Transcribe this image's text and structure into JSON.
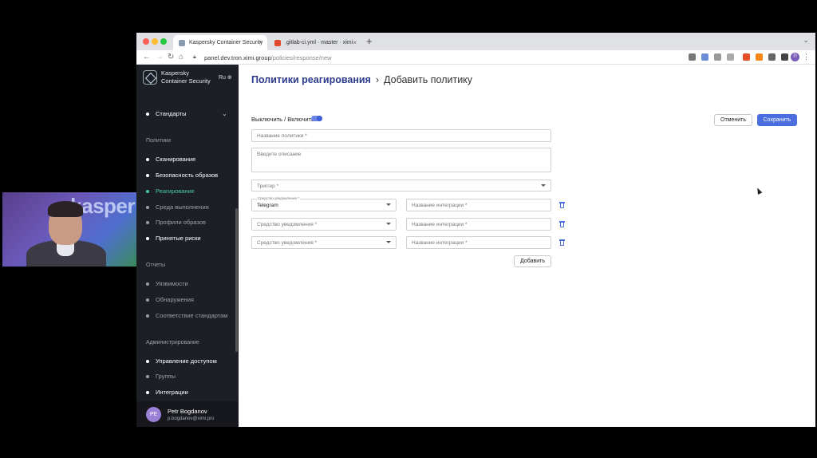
{
  "webcam": {
    "brand_text": "kasper"
  },
  "browser": {
    "tabs": [
      {
        "title": "Kaspersky Container Security",
        "favicon_color": "#8a9bb0"
      },
      {
        "title": ".gitlab-ci.yml · master · ximi",
        "favicon_color": "#e2492f"
      }
    ],
    "new_tab_icon": "+",
    "address": {
      "host": "panel.dev.tron.ximi.group",
      "path": "/policies/response/new"
    }
  },
  "sidebar": {
    "brand_line1": "Kaspersky",
    "brand_line2": "Container Security",
    "lang": "Ru",
    "items": {
      "standards": "Стандарты",
      "section_policies": "Политики",
      "scanning": "Сканирование",
      "image_security": "Безопасность образов",
      "response": "Реагирование",
      "runtime": "Среда выполнения",
      "image_profiles": "Профили образов",
      "accepted_risks": "Принятые риски",
      "section_reports": "Отчеты",
      "vulnerabilities": "Уязвимости",
      "detections": "Обнаружения",
      "compliance": "Соответствие стандартам",
      "section_admin": "Администрирование",
      "access_control": "Управление доступом",
      "groups": "Группы",
      "integrations": "Интеграции"
    },
    "user": {
      "initials": "PE",
      "name": "Petr Bogdanov",
      "email": "p.bogdanov@ximi.pro"
    }
  },
  "main": {
    "breadcrumb_root": "Политики реагирования",
    "breadcrumb_sep": "›",
    "breadcrumb_current": "Добавить политику",
    "toggle_label": "Выключить / Включить",
    "toggle_on": true,
    "cancel_label": "Отменить",
    "save_label": "Сохранить",
    "policy_name_placeholder": "Название политики *",
    "description_placeholder": "Введите описание",
    "trigger_placeholder": "Триггер *",
    "notify_rows": [
      {
        "label": "Средство уведомления *",
        "value": "Telegram",
        "integration_placeholder": "Название интеграции *"
      },
      {
        "label": "Средство уведомления *",
        "value": "",
        "integration_placeholder": "Название интеграции *"
      },
      {
        "label": "Средство уведомления *",
        "value": "",
        "integration_placeholder": "Название интеграции *"
      }
    ],
    "add_label": "Добавить"
  },
  "colors": {
    "accent": "#4a6ee0",
    "active_nav": "#49c9a8",
    "sidebar_bg": "#1d1f26",
    "title": "#2c3a8c"
  }
}
